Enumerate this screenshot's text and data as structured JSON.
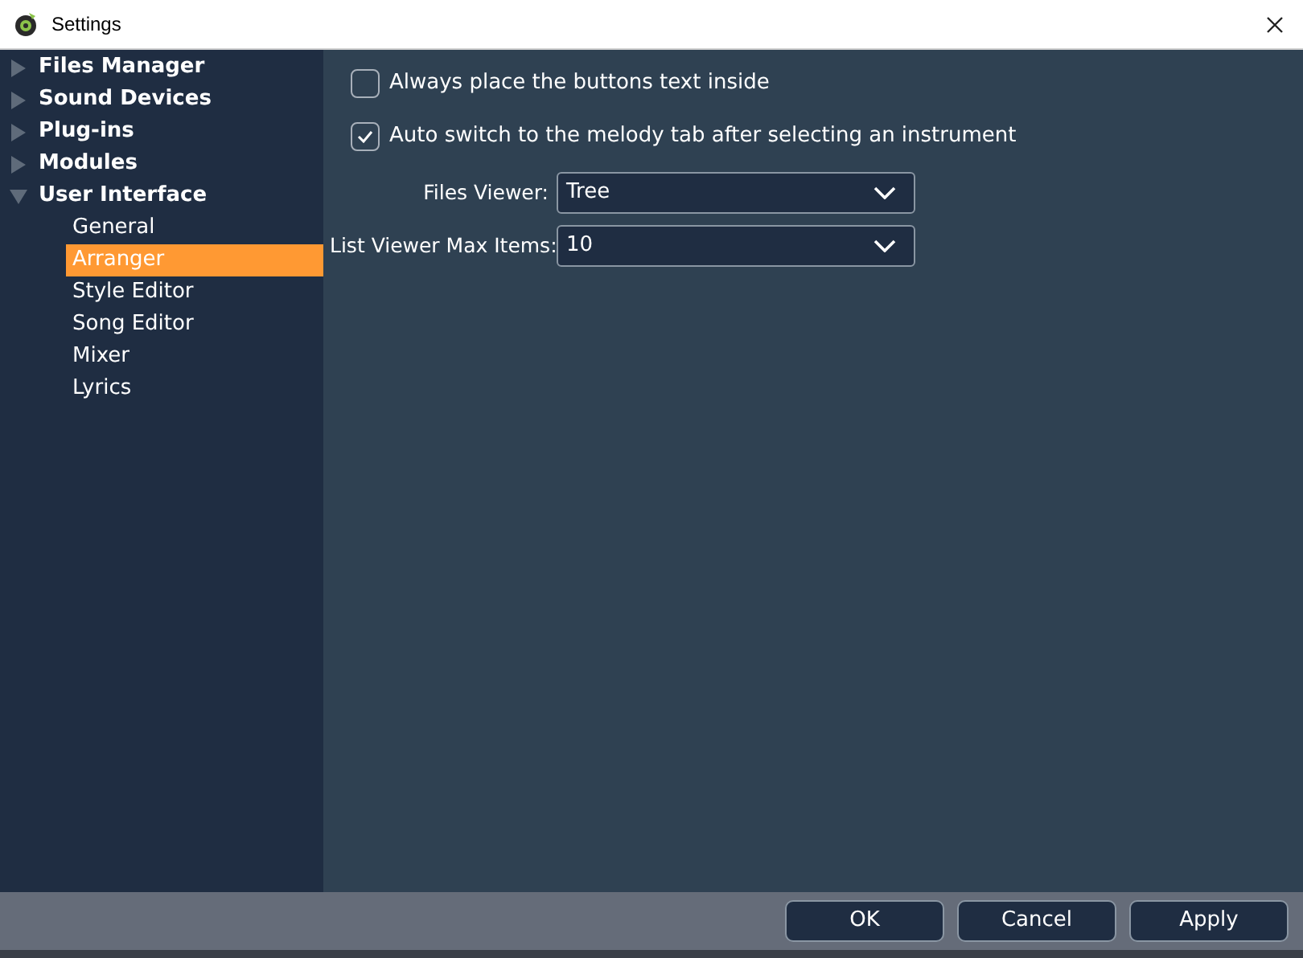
{
  "window": {
    "title": "Settings"
  },
  "sidebar": {
    "items": [
      {
        "label": "Files Manager",
        "expanded": false,
        "selected": false
      },
      {
        "label": "Sound Devices",
        "expanded": false,
        "selected": false
      },
      {
        "label": "Plug-ins",
        "expanded": false,
        "selected": false
      },
      {
        "label": "Modules",
        "expanded": false,
        "selected": false
      },
      {
        "label": "User Interface",
        "expanded": true,
        "selected": false,
        "children": [
          {
            "label": "General",
            "selected": false
          },
          {
            "label": "Arranger",
            "selected": true
          },
          {
            "label": "Style Editor",
            "selected": false
          },
          {
            "label": "Song Editor",
            "selected": false
          },
          {
            "label": "Mixer",
            "selected": false
          },
          {
            "label": "Lyrics",
            "selected": false
          }
        ]
      }
    ]
  },
  "options": [
    {
      "kind": "checkbox",
      "label": "Always place the buttons text inside",
      "checked": false
    },
    {
      "kind": "checkbox",
      "label": "Auto switch to the melody tab after selecting an instrument",
      "checked": true
    },
    {
      "kind": "dropdown",
      "label": "Files Viewer:",
      "value": "Tree"
    },
    {
      "kind": "dropdown",
      "label": "List Viewer Max Items:",
      "value": "10"
    }
  ],
  "buttons": [
    "OK",
    "Cancel",
    "Apply"
  ]
}
